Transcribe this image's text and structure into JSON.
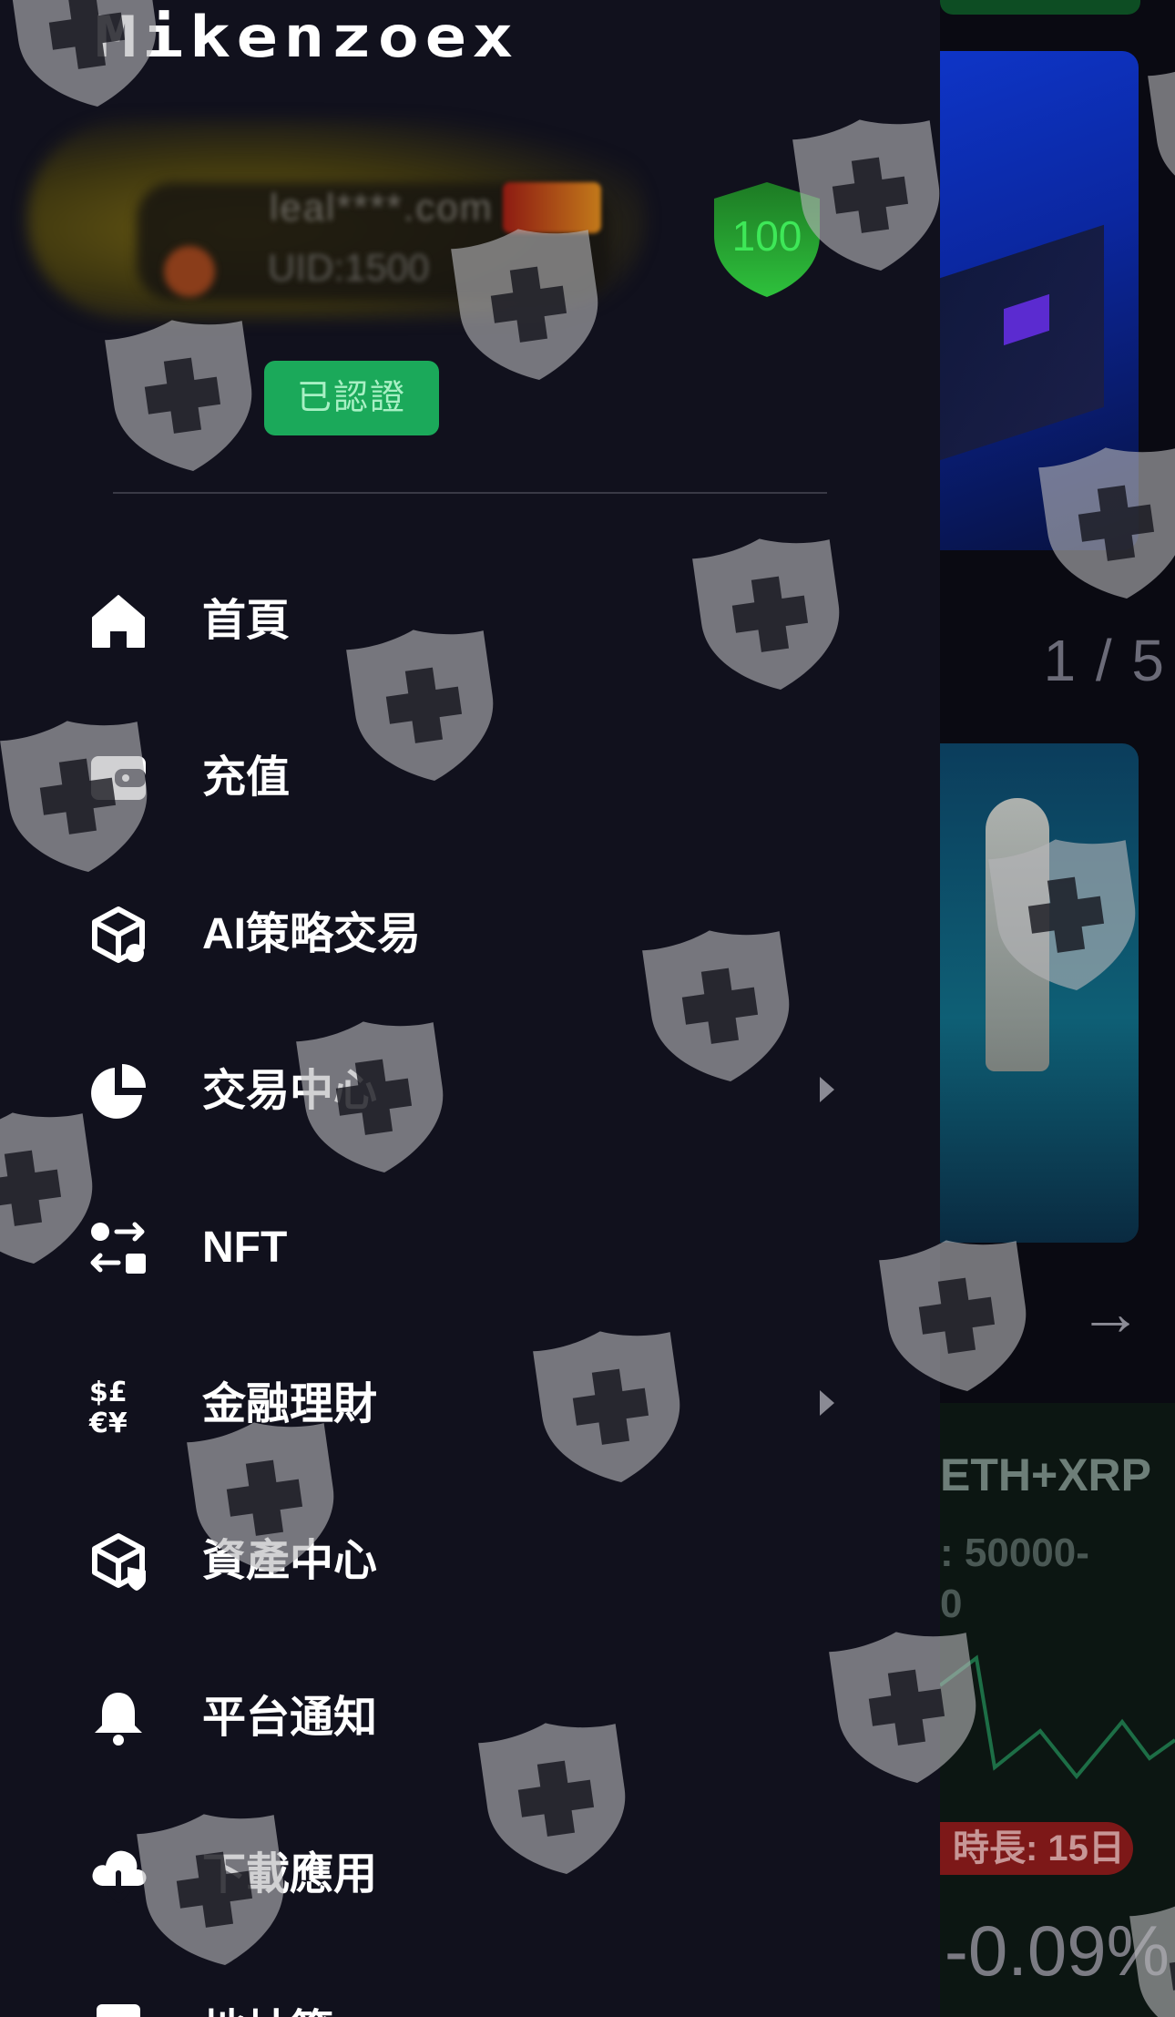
{
  "background": {
    "pager": "1 / 5",
    "arrow_icon": "arrow-right-icon",
    "coin_text": "ETH+XRP",
    "range_text": ": 50000-",
    "range_text_2": "0",
    "duration_badge": "時長: 15日",
    "change_percent": "-0.09%"
  },
  "drawer": {
    "logo": "Mikenzoex",
    "user": {
      "email": "leal****.com",
      "uid": "UID:1500",
      "security_score": "100",
      "verified_label": "已認證"
    },
    "menu": [
      {
        "label": "首頁",
        "icon": "home-icon",
        "has_submenu": false
      },
      {
        "label": "充值",
        "icon": "wallet-icon",
        "has_submenu": false
      },
      {
        "label": "AI策略交易",
        "icon": "ai-cube-icon",
        "has_submenu": false
      },
      {
        "label": "交易中心",
        "icon": "pie-chart-icon",
        "has_submenu": true
      },
      {
        "label": "NFT",
        "icon": "exchange-icon",
        "has_submenu": false
      },
      {
        "label": "金融理財",
        "icon": "currency-icon",
        "has_submenu": true
      },
      {
        "label": "資產中心",
        "icon": "shield-box-icon",
        "has_submenu": false
      },
      {
        "label": "平台通知",
        "icon": "bell-icon",
        "has_submenu": false
      },
      {
        "label": "下載應用",
        "icon": "cloud-download-icon",
        "has_submenu": false
      },
      {
        "label": "地址簿",
        "icon": "address-book-icon",
        "has_submenu": false
      }
    ]
  },
  "colors": {
    "drawer_bg": "#11111d",
    "verified_green": "#1ba95a",
    "shield_green": "#2ec13c"
  }
}
